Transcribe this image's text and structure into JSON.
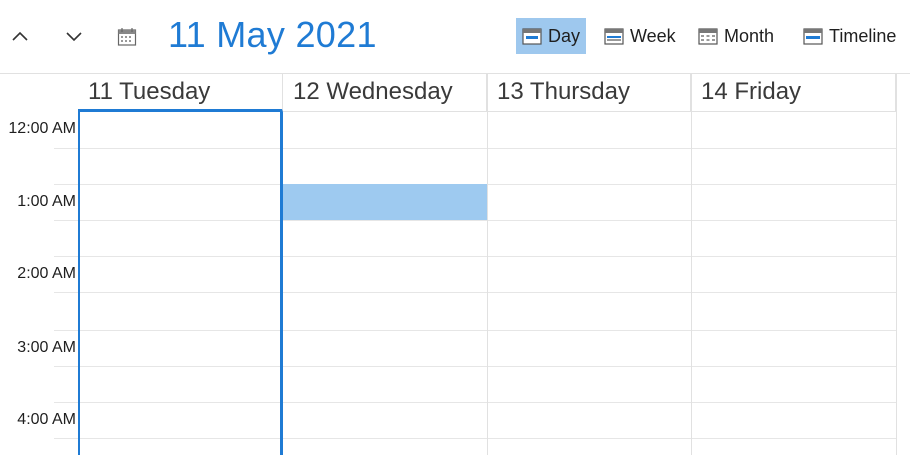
{
  "toolbar": {
    "title": "11 May 2021",
    "views": [
      {
        "label": "Day",
        "icon": "calendar-day-icon",
        "active": true
      },
      {
        "label": "Week",
        "icon": "calendar-week-icon",
        "active": false
      },
      {
        "label": "Month",
        "icon": "calendar-month-icon",
        "active": false
      },
      {
        "label": "Timeline",
        "icon": "calendar-timeline-icon",
        "active": false
      }
    ]
  },
  "days": [
    {
      "label": "11 Tuesday"
    },
    {
      "label": "12 Wednesday"
    },
    {
      "label": "13 Thursday"
    },
    {
      "label": "14 Friday"
    }
  ],
  "times": [
    "12:00 AM",
    "1:00 AM",
    "2:00 AM",
    "3:00 AM",
    "4:00 AM"
  ],
  "colors": {
    "accent": "#1f7bd4",
    "selection": "#9ecaf0",
    "active_view": "#9ec8ee"
  }
}
